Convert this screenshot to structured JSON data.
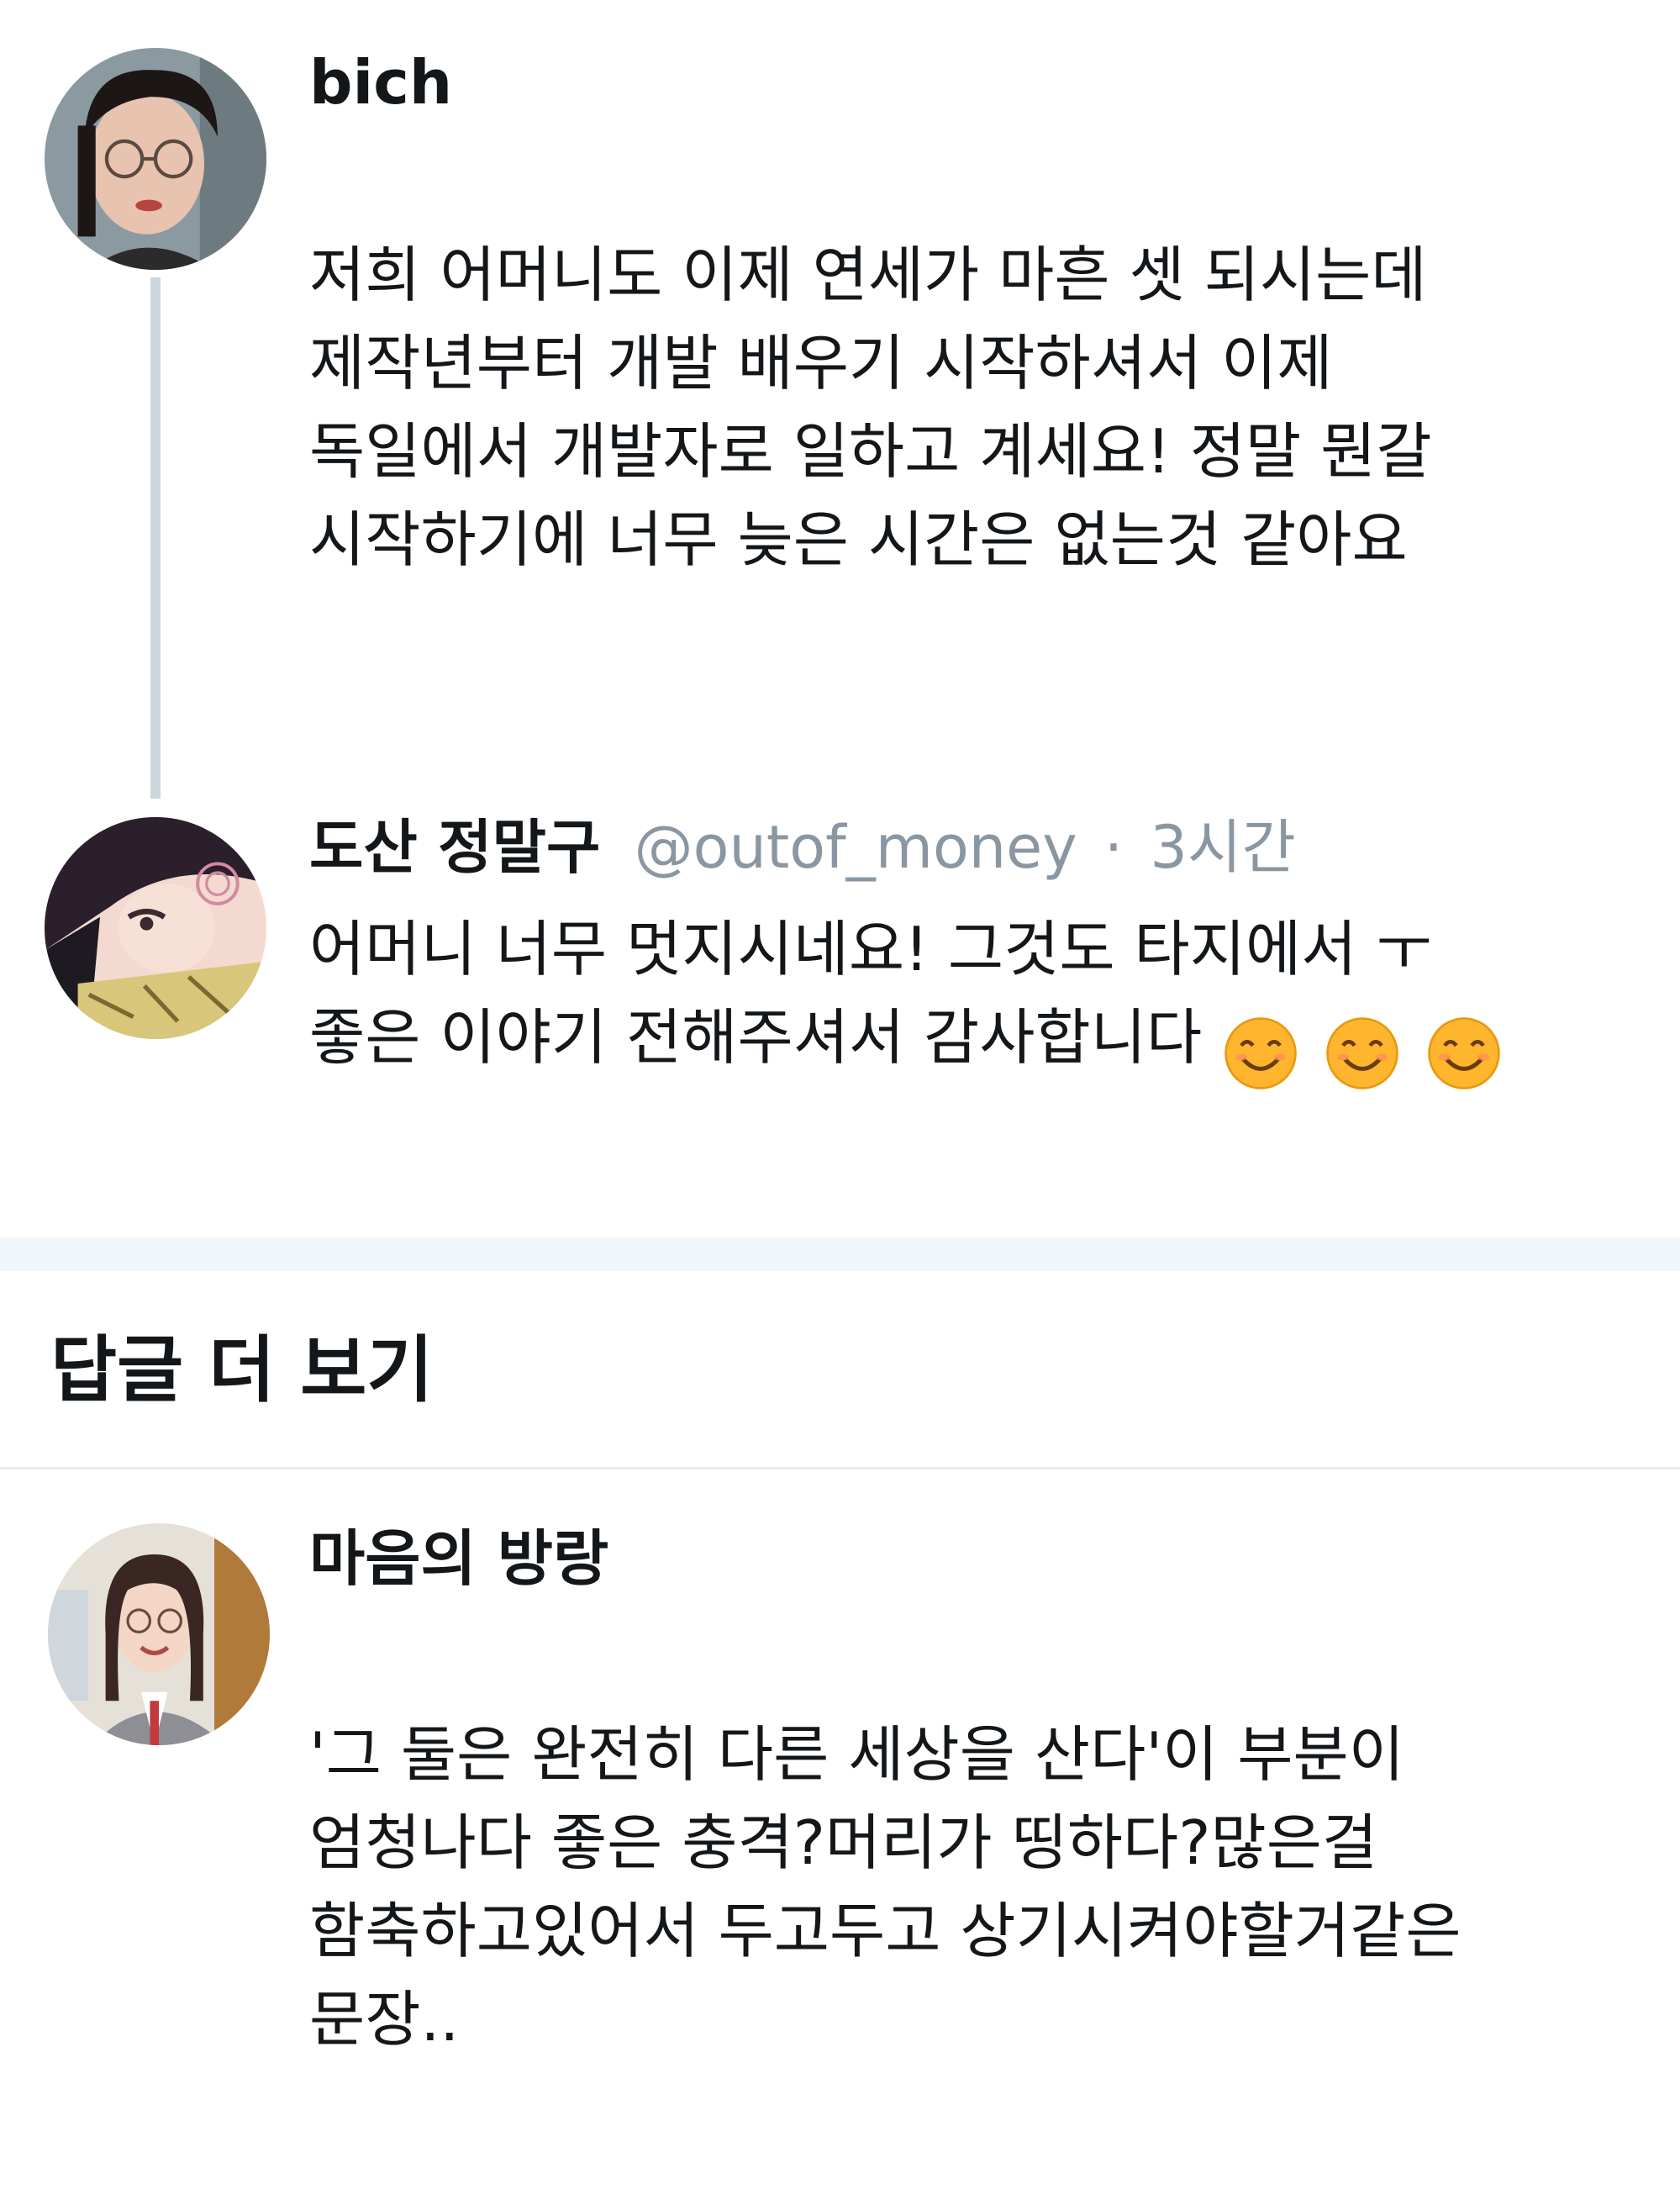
{
  "thread": {
    "tweet1": {
      "display_name": "bich",
      "lines": [
        "저희 어머니도 이제 연세가 마흔 셋 되시는데",
        "제작년부터 개발 배우기 시작하셔서 이제",
        "독일에서 개발자로 일하고 계세요! 정말 뭔갈",
        "시작하기에 너무 늦은 시간은 없는것 같아요"
      ]
    },
    "tweet2": {
      "display_name": "도산 정말구",
      "handle": "@outof_money",
      "separator": "·",
      "time": "3시간",
      "lines": [
        "어머니 너무 멋지시네요! 그것도 타지에서 ㅜ",
        "좋은 이야기 전해주셔서 감사합니다"
      ],
      "emojis": [
        "smiling-face-emoji",
        "smiling-face-emoji",
        "smiling-face-emoji"
      ]
    }
  },
  "more_replies": {
    "label": "답글 더 보기"
  },
  "reply": {
    "display_name": "마음의 방랑",
    "lines": [
      "'그 둘은 완전히 다른 세상을 산다'이 부분이",
      "엄청나다 좋은 충격?머리가 띵하다?많은걸",
      "함축하고있어서 두고두고 상기시켜야할거같은",
      "문장.."
    ]
  },
  "colors": {
    "text": "#14171a",
    "secondary_text": "#8a97a3",
    "thread_line": "#ccd6dd",
    "section_divider": "#f0f6fb",
    "emoji_fill": "#ffb62e"
  }
}
